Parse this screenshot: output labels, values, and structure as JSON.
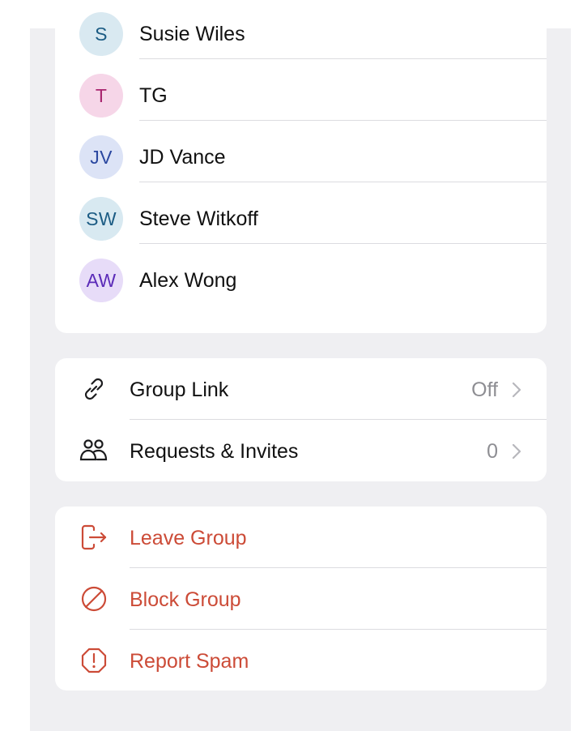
{
  "members": [
    {
      "initials": "S",
      "name": "Susie Wiles",
      "bg": "#d9e9f1",
      "fg": "#1c5c84"
    },
    {
      "initials": "T",
      "name": "TG",
      "bg": "#f6d6e8",
      "fg": "#a8246e"
    },
    {
      "initials": "JV",
      "name": "JD Vance",
      "bg": "#dce3f6",
      "fg": "#2a47a0"
    },
    {
      "initials": "SW",
      "name": "Steve Witkoff",
      "bg": "#d8e9f1",
      "fg": "#1c5c84"
    },
    {
      "initials": "AW",
      "name": "Alex Wong",
      "bg": "#e7dcf8",
      "fg": "#5b2bb8"
    }
  ],
  "settings": {
    "group_link": {
      "label": "Group Link",
      "value": "Off",
      "icon": "link-icon"
    },
    "requests": {
      "label": "Requests & Invites",
      "value": "0",
      "icon": "people-icon"
    }
  },
  "actions": {
    "leave": {
      "label": "Leave Group",
      "icon": "leave-icon"
    },
    "block": {
      "label": "Block Group",
      "icon": "block-icon"
    },
    "report": {
      "label": "Report Spam",
      "icon": "report-icon"
    }
  },
  "colors": {
    "destructive": "#cc4b37",
    "secondary": "#8e8e93",
    "background": "#efeff2"
  }
}
